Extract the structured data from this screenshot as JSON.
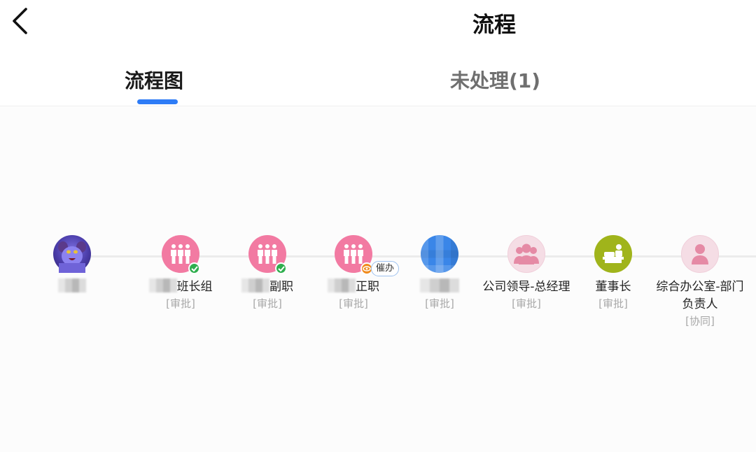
{
  "header": {
    "title": "流程",
    "back_icon": "chevron-left-icon"
  },
  "tabs": [
    {
      "label": "流程图",
      "active": true
    },
    {
      "label": "未处理(1)",
      "active": false
    }
  ],
  "colors": {
    "accent": "#2e7cf6",
    "node_pink": "#f27aa2",
    "node_light_pink": "#f5dde5",
    "node_olive": "#a0b41b",
    "approved_green": "#2fae4e",
    "pending_orange": "#f08b1d"
  },
  "flow": {
    "nodes": [
      {
        "name_visible": "",
        "name_redacted": true,
        "type": "",
        "avatar": "user-photo",
        "status": "initiator"
      },
      {
        "name_visible": "班长组",
        "name_redacted": true,
        "type": "[审批]",
        "avatar": "group-icon",
        "status": "approved"
      },
      {
        "name_visible": "副职",
        "name_redacted": true,
        "type": "[审批]",
        "avatar": "group-icon",
        "status": "approved"
      },
      {
        "name_visible": "正职",
        "name_redacted": true,
        "type": "[审批]",
        "avatar": "group-icon",
        "status": "in-progress",
        "action_label": "催办"
      },
      {
        "name_visible": "",
        "name_redacted": true,
        "type": "[审批]",
        "avatar": "user-photo",
        "status": "waiting"
      },
      {
        "name_visible": "公司领导-总经理",
        "name_redacted": false,
        "type": "[审批]",
        "avatar": "group-icon",
        "status": "waiting"
      },
      {
        "name_visible": "董事长",
        "name_redacted": false,
        "type": "[审批]",
        "avatar": "chairman-icon",
        "status": "waiting"
      },
      {
        "name_visible": "综合办公室-部门负责人",
        "name_redacted": false,
        "type": "[协同]",
        "avatar": "person-icon",
        "status": "waiting"
      }
    ]
  }
}
